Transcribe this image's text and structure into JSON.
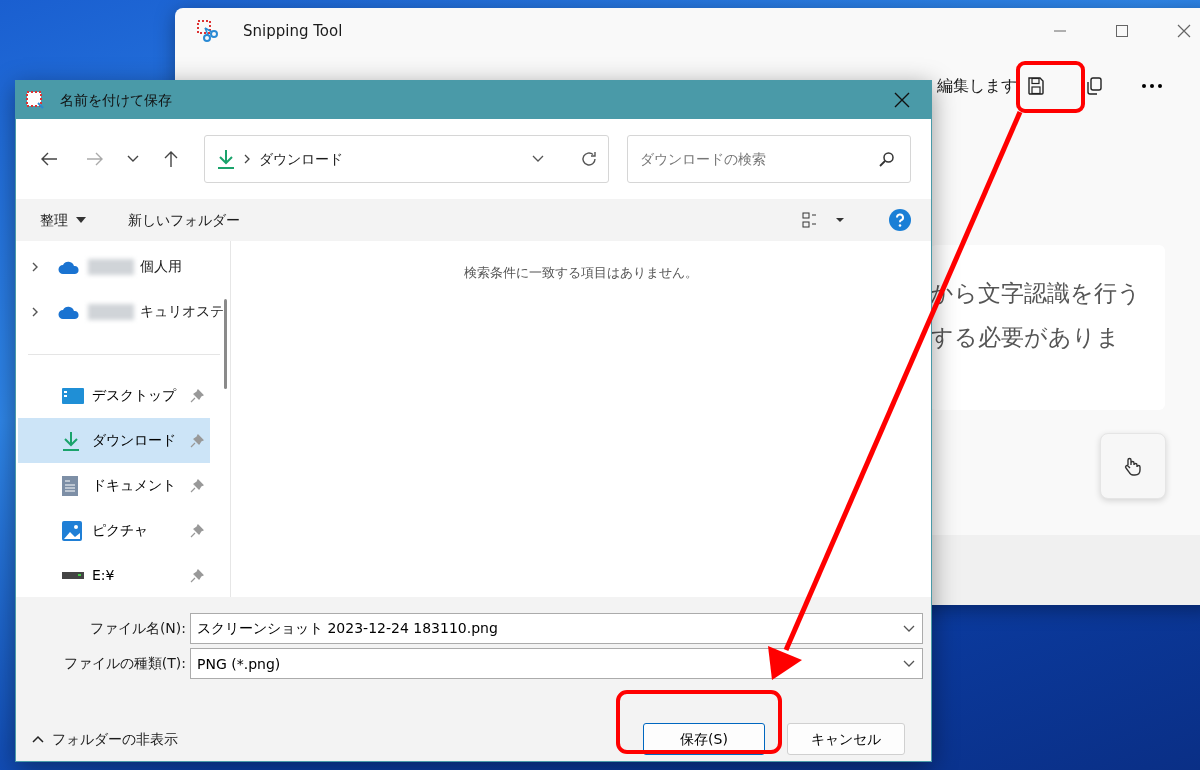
{
  "snipping_tool": {
    "title": "Snipping Tool",
    "toolbar_text": "編集します",
    "card_lines": [
      "から文字認識を行う",
      "する必要がありま"
    ]
  },
  "dialog": {
    "title": "名前を付けて保存",
    "address": {
      "location": "ダウンロード"
    },
    "search": {
      "placeholder": "ダウンロードの検索"
    },
    "commands": [
      {
        "label": "整理",
        "dropdown": true
      },
      {
        "label": "新しいフォルダー",
        "dropdown": false
      }
    ],
    "cloud_items": [
      {
        "label": "個人用",
        "expanded": false
      },
      {
        "label": "キュリオステ",
        "expanded": false
      }
    ],
    "quick_access": [
      {
        "label": "デスクトップ",
        "kind": "desktop",
        "selected": false,
        "pinned": true
      },
      {
        "label": "ダウンロード",
        "kind": "download",
        "selected": true,
        "pinned": true
      },
      {
        "label": "ドキュメント",
        "kind": "document",
        "selected": false,
        "pinned": true
      },
      {
        "label": "ピクチャ",
        "kind": "picture",
        "selected": false,
        "pinned": true
      },
      {
        "label": "E:¥",
        "kind": "drive",
        "selected": false,
        "pinned": true
      }
    ],
    "empty_message": "検索条件に一致する項目はありません。",
    "fields": [
      {
        "label": "ファイル名(N):",
        "value": "スクリーンショット 2023-12-24 183110.png"
      },
      {
        "label": "ファイルの種類(T):",
        "value": "PNG (*.png)"
      }
    ],
    "hide_folders": "フォルダーの非表示",
    "buttons": [
      {
        "label": "保存(S)",
        "kind": "primary"
      },
      {
        "label": "キャンセル",
        "kind": "secondary"
      }
    ]
  }
}
